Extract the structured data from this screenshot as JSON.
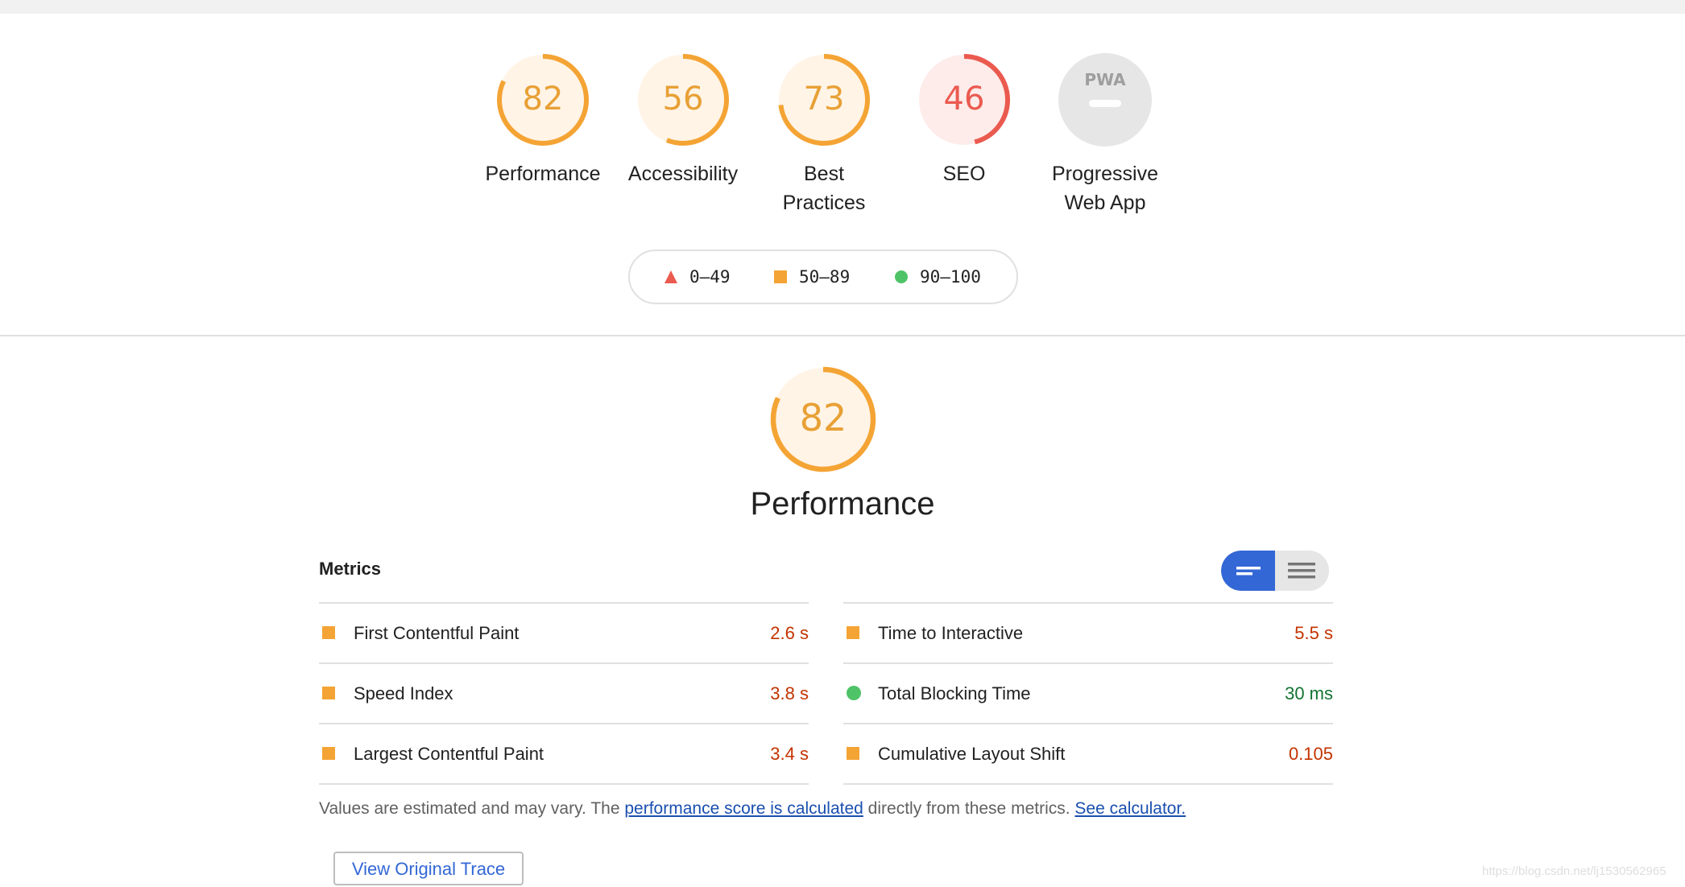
{
  "colors": {
    "average": "#f4a434",
    "average_bg": "#fff4e6",
    "average_text": "#e8a035",
    "fail": "#eb5a4f",
    "fail_bg": "#fdecea",
    "pass": "#4fc367",
    "pwa_bg": "#e6e6e6",
    "accent": "#3367d6"
  },
  "gauges": [
    {
      "score": "82",
      "label": "Performance",
      "fraction": 0.82,
      "status": "average"
    },
    {
      "score": "56",
      "label": "Accessibility",
      "fraction": 0.56,
      "status": "average"
    },
    {
      "score": "73",
      "label": "Best Practices",
      "fraction": 0.73,
      "status": "average"
    },
    {
      "score": "46",
      "label": "SEO",
      "fraction": 0.46,
      "status": "fail"
    },
    {
      "score": "",
      "label": "Progressive Web App",
      "badge": "PWA",
      "status": "na"
    }
  ],
  "legend": {
    "fail": "0–49",
    "average": "50–89",
    "pass": "90–100"
  },
  "performance": {
    "score": "82",
    "fraction": 0.82,
    "title": "Performance",
    "metrics_title": "Metrics",
    "metrics_left": [
      {
        "label": "First Contentful Paint",
        "value": "2.6 s",
        "status": "average"
      },
      {
        "label": "Speed Index",
        "value": "3.8 s",
        "status": "average"
      },
      {
        "label": "Largest Contentful Paint",
        "value": "3.4 s",
        "status": "average"
      }
    ],
    "metrics_right": [
      {
        "label": "Time to Interactive",
        "value": "5.5 s",
        "status": "average"
      },
      {
        "label": "Total Blocking Time",
        "value": "30 ms",
        "status": "pass"
      },
      {
        "label": "Cumulative Layout Shift",
        "value": "0.105",
        "status": "average"
      }
    ],
    "note_prefix": "Values are estimated and may vary. The ",
    "note_link1": "performance score is calculated",
    "note_middle": " directly from these metrics. ",
    "note_link2": "See calculator.",
    "trace_button": "View Original Trace"
  },
  "watermark": "https://blog.csdn.net/lj1530562965"
}
